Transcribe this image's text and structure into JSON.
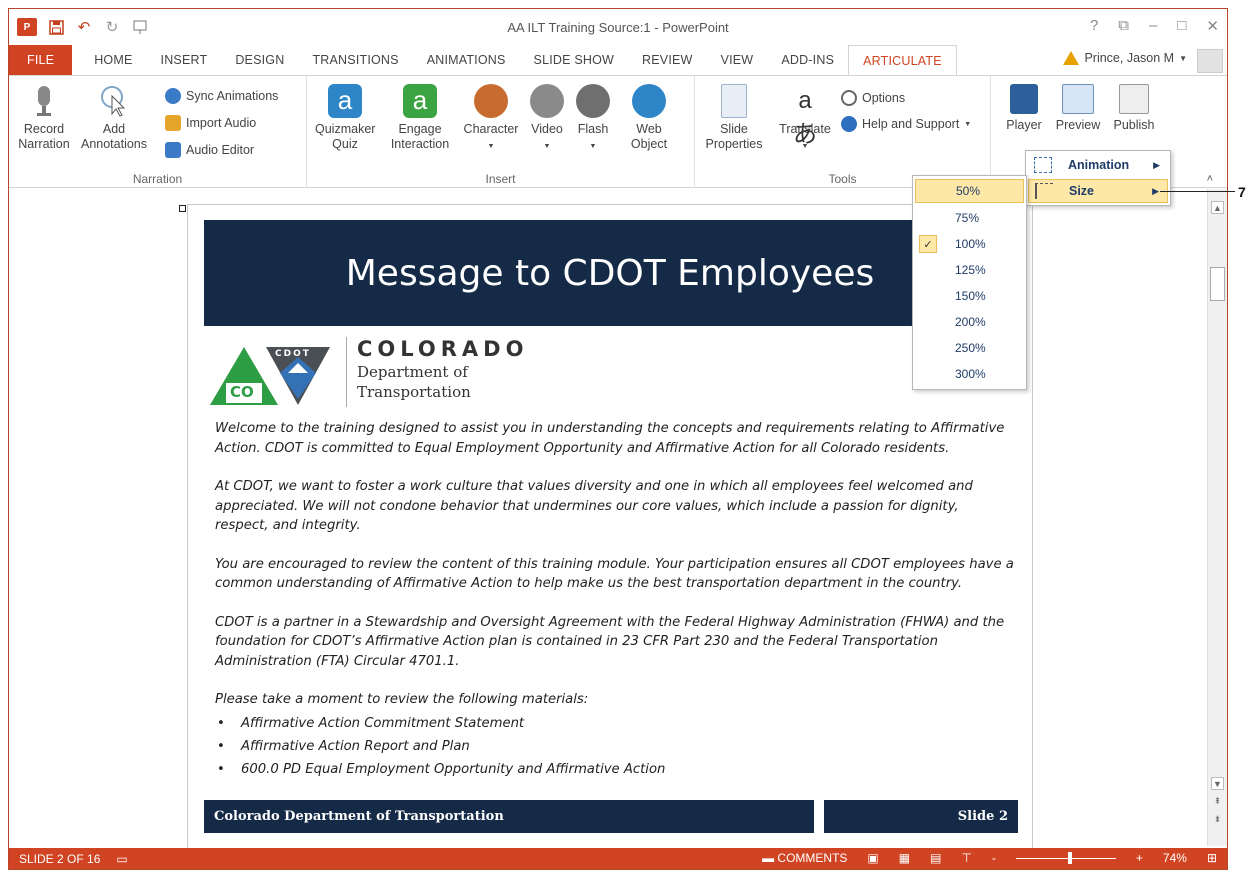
{
  "window": {
    "title": "AA ILT Training Source:1 - PowerPoint",
    "controls": [
      "?",
      "⧉",
      "–",
      "□",
      "✕"
    ]
  },
  "quick_access": {
    "undo_glyph": "↶",
    "redo_glyph": "↻"
  },
  "tabs": [
    "FILE",
    "HOME",
    "INSERT",
    "DESIGN",
    "TRANSITIONS",
    "ANIMATIONS",
    "SLIDE SHOW",
    "REVIEW",
    "VIEW",
    "ADD-INS",
    "ARTICULATE"
  ],
  "active_tab": "ARTICULATE",
  "user": {
    "name": "Prince, Jason M"
  },
  "ribbon": {
    "narration": {
      "label": "Narration",
      "record": "Record\nNarration",
      "add": "Add\nAnnotations",
      "sync": "Sync Animations",
      "import": "Import Audio",
      "editor": "Audio Editor"
    },
    "insert": {
      "label": "Insert",
      "quizmaker": "Quizmaker\nQuiz",
      "engage": "Engage\nInteraction",
      "character": "Character",
      "video": "Video",
      "flash": "Flash",
      "web": "Web\nObject"
    },
    "tools": {
      "label": "Tools",
      "slide_props": "Slide\nProperties",
      "translate": "Translate",
      "options": "Options",
      "help": "Help and Support"
    },
    "publish": {
      "player": "Player",
      "preview": "Preview",
      "publish": "Publish"
    }
  },
  "context_menu": {
    "items": [
      {
        "label": "Animation"
      },
      {
        "label": "Size"
      }
    ],
    "highlighted": "Size"
  },
  "size_menu": {
    "options": [
      "50%",
      "75%",
      "100%",
      "125%",
      "150%",
      "200%",
      "250%",
      "300%"
    ],
    "highlighted": "50%",
    "checked": "100%"
  },
  "callout": {
    "number": "7"
  },
  "slide": {
    "title": "Message to CDOT Employees",
    "logo_badge": "CDOT",
    "logo_co": "CO",
    "logo_state": "COLORADO",
    "logo_dept_1": "Department of",
    "logo_dept_2": "Transportation",
    "paragraphs": [
      "Welcome to the training designed to assist you in understanding the concepts and requirements relating to Affirmative Action. CDOT is committed to Equal Employment Opportunity and Affirmative Action for all Colorado residents.",
      "At CDOT, we want to foster a work culture that values diversity and one in which all employees feel welcomed and appreciated. We will not condone behavior that undermines our core values, which include a passion for dignity, respect, and integrity.",
      "You are encouraged to review the content of this training module. Your participation ensures all CDOT employees have a common understanding of Affirmative Action to help make us the best transportation department in the country.",
      "CDOT is a partner in a Stewardship and Oversight Agreement with the Federal Highway Administration (FHWA) and the foundation for CDOT’s Affirmative Action plan is contained in  23 CFR Part 230 and the Federal Transportation Administration (FTA) Circular 4701.1."
    ],
    "list_intro": "Please take a moment to review the following materials:",
    "bullets": [
      "Affirmative Action Commitment Statement",
      "Affirmative Action Report and Plan",
      "600.0 PD Equal Employment Opportunity and Affirmative Action"
    ],
    "footer_left": "Colorado Department of Transportation",
    "footer_right": "Slide 2"
  },
  "status": {
    "slide_counter": "SLIDE 2 OF 16",
    "comments": "COMMENTS",
    "zoom_minus": "-",
    "zoom_plus": "+",
    "zoom": "74%"
  },
  "colors": {
    "accent": "#d04423",
    "slide_navy": "#152a47",
    "menu_highlight": "#fde8a8",
    "menu_text": "#1f3c67"
  }
}
